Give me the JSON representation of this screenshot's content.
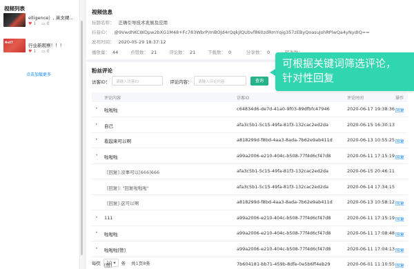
{
  "left": {
    "title": "视频列表",
    "videos": [
      {
        "title": "elligence）, 英文碑...",
        "likes": "1",
        "comments": "0"
      },
      {
        "title": "行业新观察！！！",
        "likes": "1",
        "comments": "0"
      }
    ],
    "load_more": "点击加载更多",
    "thumb2_tag": "NeXT"
  },
  "video_info": {
    "section_title": "视频信息",
    "title_label": "标题名称：",
    "title_value": "正确引导技术发展及应用",
    "id_label": "抖音ID：",
    "id_value": "@9VwdhKCWDpw2bXG1M48+Fc783WbrP/mBOJd4rQqkJlQUbvf860zdRmYqig357zEByQoasuJshRPlwQa4yNydIQ==",
    "time_label": "发布时间：",
    "time_value": "2020-05-29 18:37:12",
    "stats": [
      {
        "label": "播放量：",
        "value": "44"
      },
      {
        "label": "点赞数：",
        "value": "21"
      },
      {
        "label": "评论数：",
        "value": "21"
      },
      {
        "label": "下载数：",
        "value": "0"
      },
      {
        "label": "分享数：",
        "value": "0"
      },
      {
        "label": "转发数：",
        "value": ""
      }
    ]
  },
  "comments": {
    "section_title": "粉丝评论",
    "filter_id_label": "访客ID：",
    "filter_id_placeholder": "请输入访客ID",
    "filter_content_label": "评论内容：",
    "filter_content_placeholder": "请输入评论内容",
    "search_button": "查询",
    "columns": [
      "评论内容",
      "访客ID",
      "评论时间",
      "操作"
    ],
    "rows": [
      {
        "arrow": "▸",
        "content": "啦啦啦",
        "visitor": "c64834d6-de7d-41a0-9f03-89dfbfc47946",
        "time": "2020-06-17 19:38:36",
        "op": "回复"
      },
      {
        "arrow": "▸",
        "content": "自己",
        "visitor": "afa3c5b1-5c15-49fa-81f3-132cac2ed2da",
        "time": "2020-06-15 16:30:13",
        "op": ""
      },
      {
        "arrow": "▸",
        "content": "看起来可以啊",
        "visitor": "a818299d-f8bd-4aa3-8ada-7b62e9ab411d",
        "time": "2020-06-13 10:55:25",
        "op": "回复"
      },
      {
        "arrow": "▾",
        "content": "啦啦啦",
        "visitor": "a99a2006-e210-404c-b508-77f4d6cf47d8",
        "time": "2020-06-11 17:15:19",
        "op": "回复"
      },
      {
        "arrow": "",
        "content": "[回复]:没事可以[666]666",
        "visitor": "afa3c5b1-5c15-49fa-81f3-132cac2ed2da",
        "time": "2020-06-15 20:46:11",
        "op": ""
      },
      {
        "arrow": "",
        "content": "[回复]: \"回复啦啦啦\"",
        "visitor": "afa3c5b1-5c15-49fa-81f3-132cac2ed2da",
        "time": "2020-06-14 17:34:15",
        "op": ""
      },
      {
        "arrow": "",
        "content": "[回复]:这可以啊",
        "visitor": "a818299d-f8bd-4aa3-8ada-7b62e9ab411d",
        "time": "2020-06-13 10:58:12",
        "op": "回复"
      },
      {
        "arrow": "▸",
        "content": "111",
        "visitor": "a99a2006-e210-404c-b508-77f4d6cf47d8",
        "time": "2020-06-11 17:15:19",
        "op": "回复"
      },
      {
        "arrow": "▸",
        "content": "啦啦啦",
        "visitor": "a99a2006-e210-404c-b508-77f4d6cf47d8",
        "time": "2020-06-11 17:08:48",
        "op": "回复"
      },
      {
        "arrow": "▸",
        "content": "啦啦啦[赞]",
        "visitor": "a99a2006-e210-404c-b508-77f4d6cf47d8",
        "time": "2020-06-11 17:04:13",
        "op": "回复"
      },
      {
        "arrow": "▸",
        "content": "[赞]",
        "visitor": "7b604181-bb71-459b-8dfe-0e5b6ff4eb29",
        "time": "2020-06-01 11:10:55",
        "op": "回复"
      }
    ]
  },
  "pager": {
    "prefix": "每页",
    "page_size": "10",
    "unit": "条",
    "total": "共1页8条"
  },
  "callout": {
    "line1": "可根据关键词筛选评论，",
    "line2": "针对性回复"
  }
}
